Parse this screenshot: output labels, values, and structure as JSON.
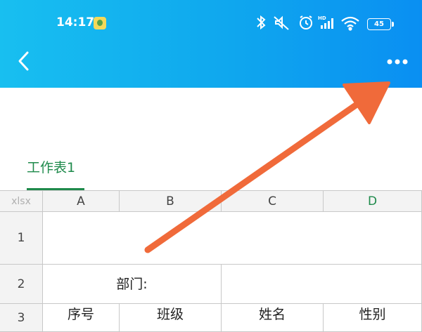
{
  "status_bar": {
    "time": "14:17",
    "battery": "45",
    "icons": [
      "bluetooth-icon",
      "mute-icon",
      "alarm-icon",
      "hd-signal-icon",
      "wifi-icon",
      "battery-icon"
    ]
  },
  "header": {
    "back_icon": "chevron-left-icon",
    "more_icon": "more-dots-icon"
  },
  "sheet_tabs": [
    {
      "label": "工作表1",
      "active": true
    }
  ],
  "spreadsheet": {
    "corner_label": "xlsx",
    "columns": [
      "A",
      "B",
      "C",
      "D"
    ],
    "rows": [
      "1",
      "2",
      "3"
    ],
    "row2_merged_text": "部门:",
    "row3_cells": [
      "序号",
      "班级",
      "姓名",
      "性别"
    ]
  },
  "annotation": {
    "arrow_color": "#f06a3a"
  },
  "colors": {
    "header_gradient_start": "#18bff0",
    "header_gradient_end": "#0a8ff2",
    "accent_green": "#1e8a4b"
  }
}
